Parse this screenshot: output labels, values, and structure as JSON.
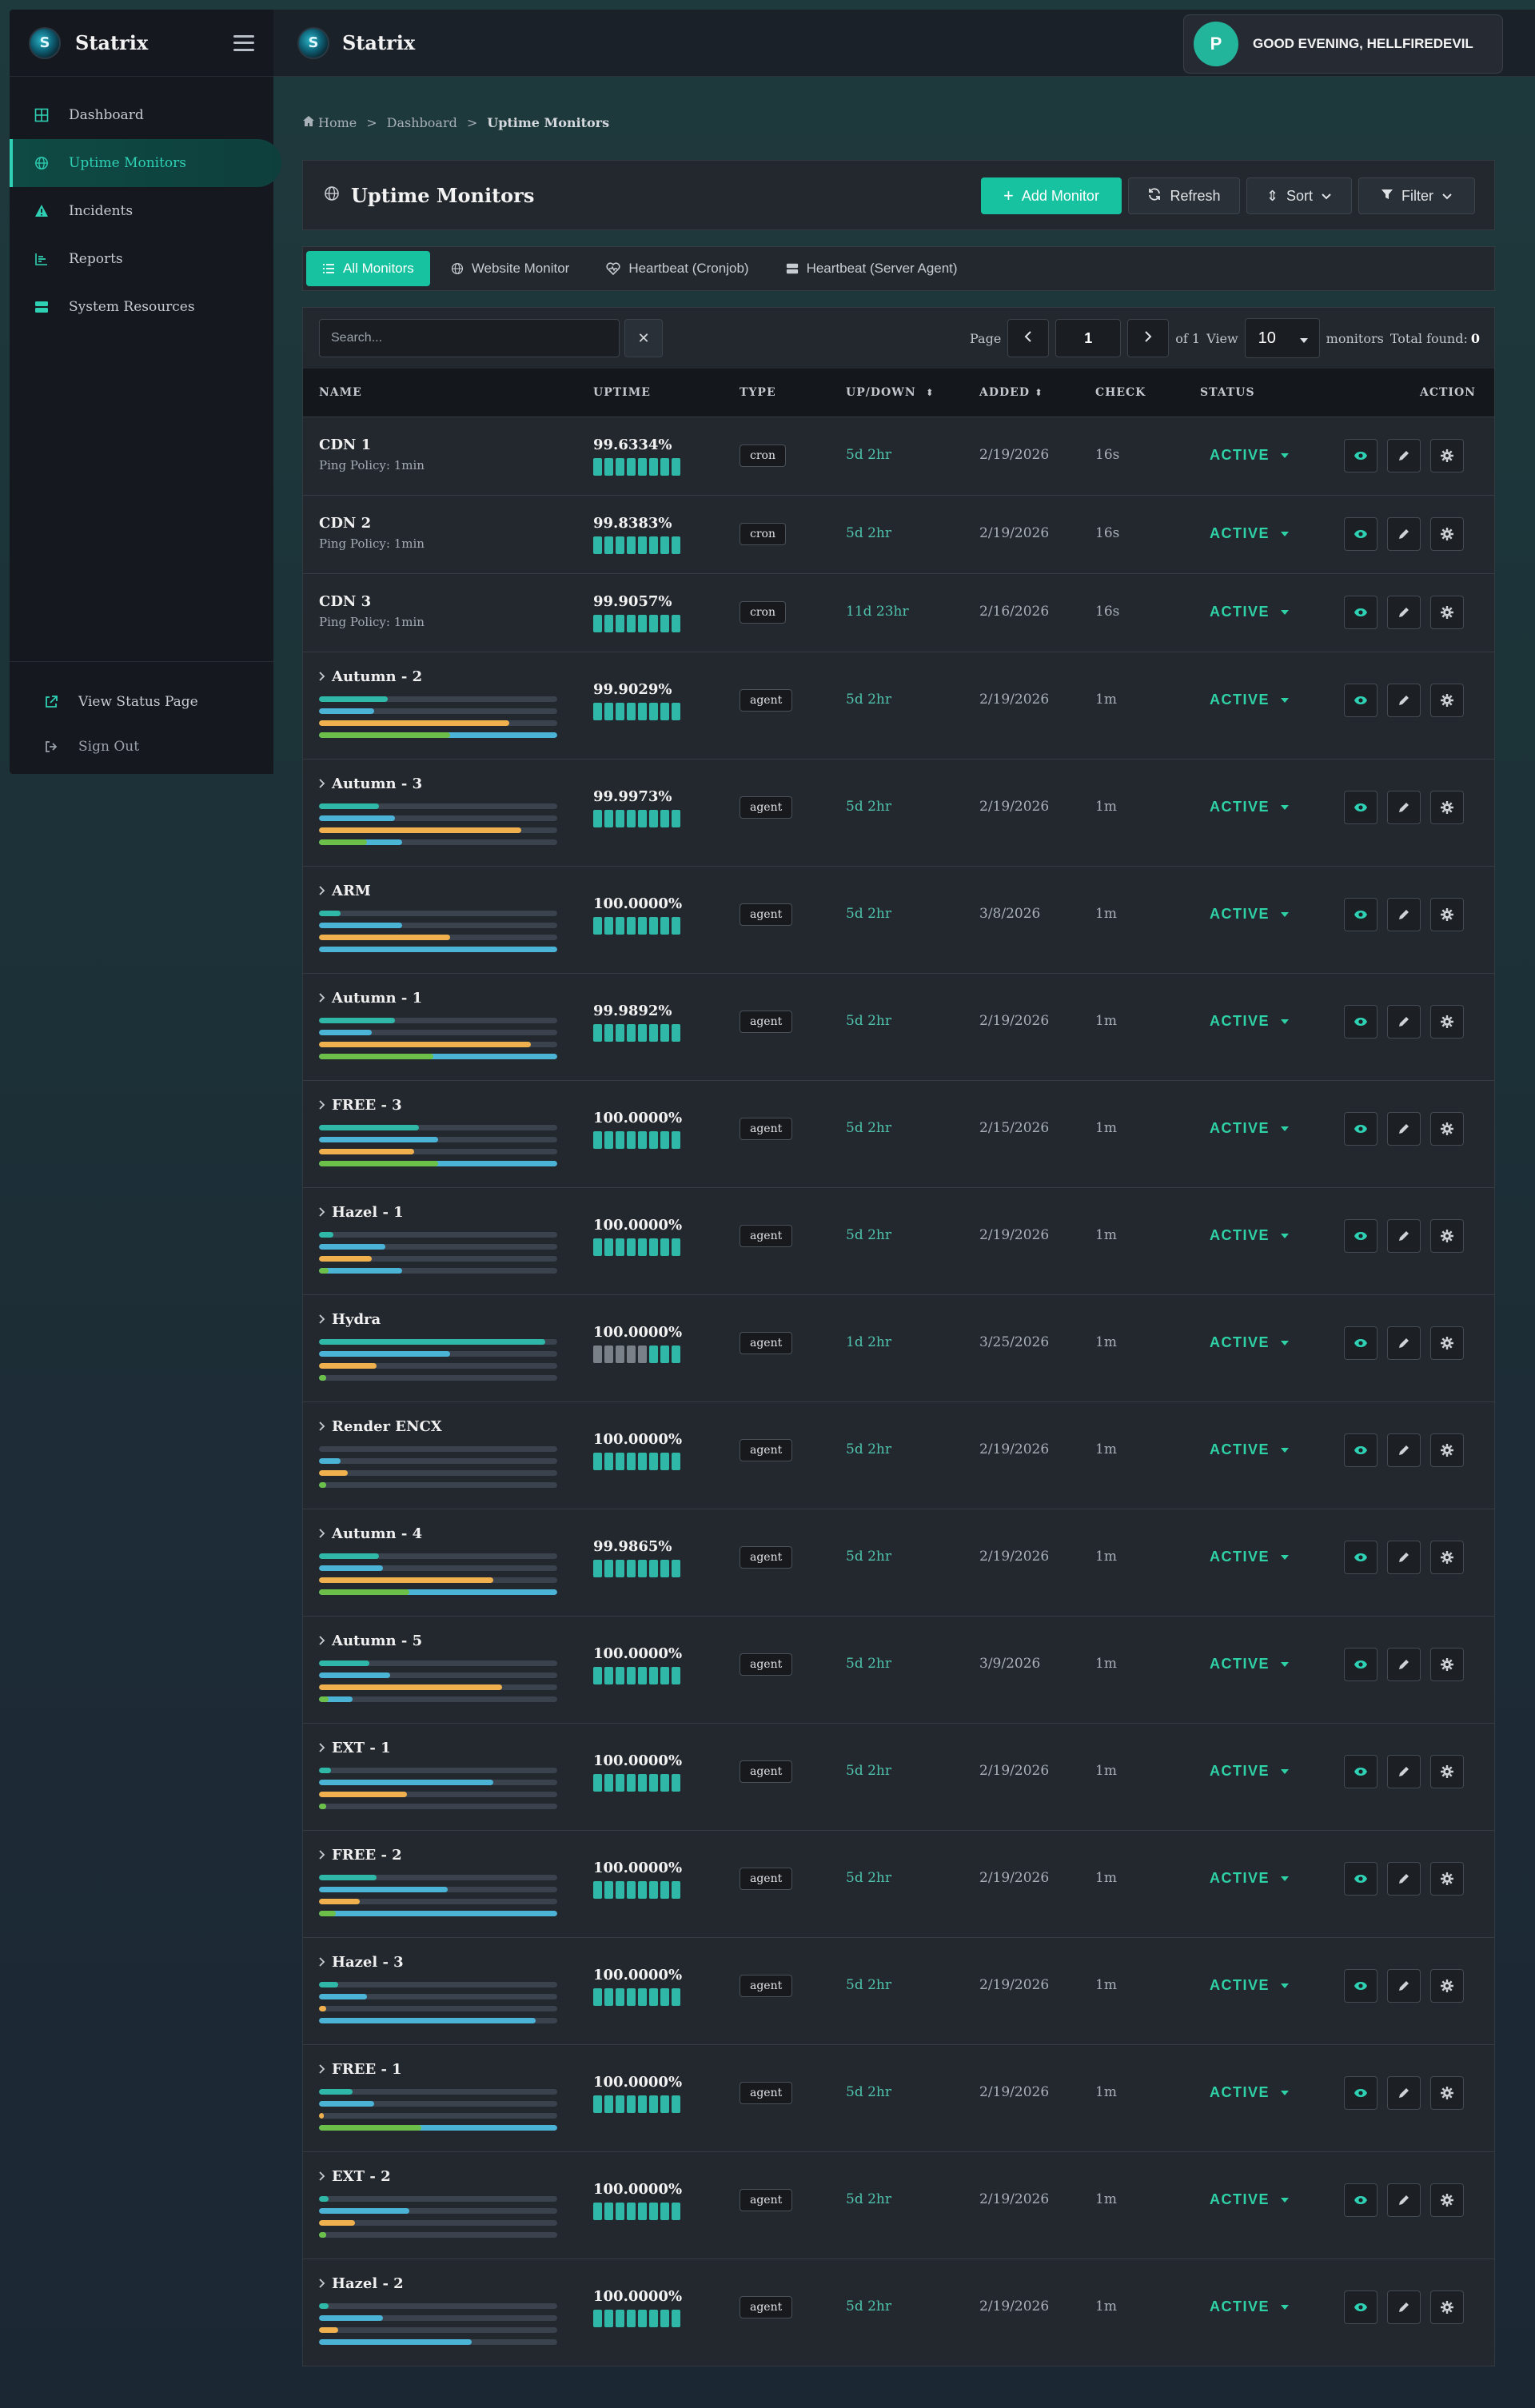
{
  "app": {
    "name": "Statrix",
    "logo_letter": "S"
  },
  "sidebar": {
    "items": [
      {
        "label": "Dashboard",
        "icon": "grid-icon",
        "active": false
      },
      {
        "label": "Uptime Monitors",
        "icon": "globe-icon",
        "active": true
      },
      {
        "label": "Incidents",
        "icon": "warning-icon",
        "active": false
      },
      {
        "label": "Reports",
        "icon": "chart-icon",
        "active": false
      },
      {
        "label": "System Resources",
        "icon": "server-icon",
        "active": false
      }
    ],
    "bottom": [
      {
        "label": "View Status Page",
        "icon": "external-link-icon"
      },
      {
        "label": "Sign Out",
        "icon": "sign-out-icon"
      }
    ]
  },
  "header": {
    "avatar_letter": "P",
    "greeting": "GOOD EVENING, HELLFIREDEVIL"
  },
  "breadcrumb": {
    "home": "Home",
    "sep": ">",
    "parent": "Dashboard",
    "current": "Uptime Monitors"
  },
  "page": {
    "title": "Uptime Monitors",
    "add_label": "Add Monitor",
    "refresh_label": "Refresh",
    "sort_label": "Sort",
    "filter_label": "Filter"
  },
  "tabs": [
    {
      "label": "All Monitors",
      "active": true
    },
    {
      "label": "Website Monitor",
      "active": false
    },
    {
      "label": "Heartbeat (Cronjob)",
      "active": false
    },
    {
      "label": "Heartbeat (Server Agent)",
      "active": false
    }
  ],
  "table": {
    "search_placeholder": "Search...",
    "clear": "✕",
    "page_label": "Page",
    "page": "1",
    "of_label": "of 1",
    "view_label": "View",
    "view_count": "10",
    "monitors_label": "monitors",
    "total_label": "Total found:",
    "total": "0",
    "headers": {
      "name": "NAME",
      "uptime": "UPTIME",
      "type": "TYPE",
      "updown": "UP/DOWN",
      "added": "ADDED",
      "check": "CHECK",
      "status": "STATUS",
      "action": "ACTION"
    },
    "rows": [
      {
        "name": "CDN 1",
        "policy": "Ping Policy: 1min",
        "uptime": "99.6334%",
        "type": "cron",
        "updown": "5d 2hr",
        "added": "2/19/2026",
        "check": "16s",
        "status": "ACTIVE"
      },
      {
        "name": "CDN 2",
        "policy": "Ping Policy: 1min",
        "uptime": "99.8383%",
        "type": "cron",
        "updown": "5d 2hr",
        "added": "2/19/2026",
        "check": "16s",
        "status": "ACTIVE"
      },
      {
        "name": "CDN 3",
        "policy": "Ping Policy: 1min",
        "uptime": "99.9057%",
        "type": "cron",
        "updown": "11d 23hr",
        "added": "2/16/2026",
        "check": "16s",
        "status": "ACTIVE"
      },
      {
        "name": "Autumn - 2",
        "uptime": "99.9029%",
        "type": "agent",
        "updown": "5d 2hr",
        "added": "2/19/2026",
        "check": "1m",
        "status": "ACTIVE",
        "bars": [
          [
            0.29,
            "#2fb8a7"
          ],
          [
            0.23,
            "#4ab3d6"
          ],
          [
            0.8,
            "#f0b04e"
          ],
          [
            1.0,
            "#4ab3d6",
            0.55
          ]
        ]
      },
      {
        "name": "Autumn - 3",
        "uptime": "99.9973%",
        "type": "agent",
        "updown": "5d 2hr",
        "added": "2/19/2026",
        "check": "1m",
        "status": "ACTIVE",
        "bars": [
          [
            0.25,
            "#2fb8a7"
          ],
          [
            0.32,
            "#4ab3d6"
          ],
          [
            0.85,
            "#f0b04e"
          ],
          [
            0.35,
            "#4ab3d6",
            0.2
          ]
        ]
      },
      {
        "name": "ARM",
        "uptime": "100.0000%",
        "type": "agent",
        "updown": "5d 2hr",
        "added": "3/8/2026",
        "check": "1m",
        "status": "ACTIVE",
        "bars": [
          [
            0.09,
            "#2fb8a7"
          ],
          [
            0.35,
            "#4ab3d6"
          ],
          [
            0.55,
            "#f0b04e"
          ],
          [
            1.0,
            "#4ab3d6",
            0.0
          ]
        ]
      },
      {
        "name": "Autumn - 1",
        "uptime": "99.9892%",
        "type": "agent",
        "updown": "5d 2hr",
        "added": "2/19/2026",
        "check": "1m",
        "status": "ACTIVE",
        "bars": [
          [
            0.32,
            "#2fb8a7"
          ],
          [
            0.22,
            "#4ab3d6"
          ],
          [
            0.89,
            "#f0b04e"
          ],
          [
            1.0,
            "#4ab3d6",
            0.48
          ]
        ]
      },
      {
        "name": "FREE - 3",
        "uptime": "100.0000%",
        "type": "agent",
        "updown": "5d 2hr",
        "added": "2/15/2026",
        "check": "1m",
        "status": "ACTIVE",
        "bars": [
          [
            0.42,
            "#2fb8a7"
          ],
          [
            0.5,
            "#4ab3d6"
          ],
          [
            0.4,
            "#f0b04e"
          ],
          [
            1.0,
            "#4ab3d6",
            0.5
          ]
        ]
      },
      {
        "name": "Hazel - 1",
        "uptime": "100.0000%",
        "type": "agent",
        "updown": "5d 2hr",
        "added": "2/19/2026",
        "check": "1m",
        "status": "ACTIVE",
        "bars": [
          [
            0.06,
            "#2fb8a7"
          ],
          [
            0.28,
            "#4ab3d6"
          ],
          [
            0.22,
            "#f0b04e"
          ],
          [
            0.35,
            "#4ab3d6",
            0.04
          ]
        ]
      },
      {
        "name": "Hydra",
        "uptime": "100.0000%",
        "type": "agent",
        "updown": "1d 2hr",
        "added": "3/25/2026",
        "check": "1m",
        "status": "ACTIVE",
        "grey_blocks": 5,
        "bars": [
          [
            0.95,
            "#2fb8a7"
          ],
          [
            0.55,
            "#4ab3d6"
          ],
          [
            0.24,
            "#f0b04e"
          ],
          [
            0.03,
            "#4ab3d6",
            0.03
          ]
        ]
      },
      {
        "name": "Render ENCX",
        "uptime": "100.0000%",
        "type": "agent",
        "updown": "5d 2hr",
        "added": "2/19/2026",
        "check": "1m",
        "status": "ACTIVE",
        "bars": [
          [
            0.0,
            "#2fb8a7"
          ],
          [
            0.09,
            "#4ab3d6"
          ],
          [
            0.12,
            "#f0b04e"
          ],
          [
            0.03,
            "#4ab3d6",
            0.03
          ]
        ]
      },
      {
        "name": "Autumn - 4",
        "uptime": "99.9865%",
        "type": "agent",
        "updown": "5d 2hr",
        "added": "2/19/2026",
        "check": "1m",
        "status": "ACTIVE",
        "bars": [
          [
            0.25,
            "#2fb8a7"
          ],
          [
            0.27,
            "#4ab3d6"
          ],
          [
            0.73,
            "#f0b04e"
          ],
          [
            1.0,
            "#4ab3d6",
            0.38
          ]
        ]
      },
      {
        "name": "Autumn - 5",
        "uptime": "100.0000%",
        "type": "agent",
        "updown": "5d 2hr",
        "added": "3/9/2026",
        "check": "1m",
        "status": "ACTIVE",
        "bars": [
          [
            0.21,
            "#2fb8a7"
          ],
          [
            0.3,
            "#4ab3d6"
          ],
          [
            0.77,
            "#f0b04e"
          ],
          [
            0.14,
            "#4ab3d6",
            0.04
          ]
        ]
      },
      {
        "name": "EXT - 1",
        "uptime": "100.0000%",
        "type": "agent",
        "updown": "5d 2hr",
        "added": "2/19/2026",
        "check": "1m",
        "status": "ACTIVE",
        "bars": [
          [
            0.05,
            "#2fb8a7"
          ],
          [
            0.73,
            "#4ab3d6"
          ],
          [
            0.37,
            "#f0b04e"
          ],
          [
            0.03,
            "#4ab3d6",
            0.03
          ]
        ]
      },
      {
        "name": "FREE - 2",
        "uptime": "100.0000%",
        "type": "agent",
        "updown": "5d 2hr",
        "added": "2/19/2026",
        "check": "1m",
        "status": "ACTIVE",
        "bars": [
          [
            0.24,
            "#2fb8a7"
          ],
          [
            0.54,
            "#4ab3d6"
          ],
          [
            0.17,
            "#f0b04e"
          ],
          [
            1.0,
            "#4ab3d6",
            0.07
          ]
        ]
      },
      {
        "name": "Hazel - 3",
        "uptime": "100.0000%",
        "type": "agent",
        "updown": "5d 2hr",
        "added": "2/19/2026",
        "check": "1m",
        "status": "ACTIVE",
        "bars": [
          [
            0.08,
            "#2fb8a7"
          ],
          [
            0.2,
            "#4ab3d6"
          ],
          [
            0.03,
            "#f0b04e"
          ],
          [
            0.91,
            "#4ab3d6",
            0.0
          ]
        ]
      },
      {
        "name": "FREE - 1",
        "uptime": "100.0000%",
        "type": "agent",
        "updown": "5d 2hr",
        "added": "2/19/2026",
        "check": "1m",
        "status": "ACTIVE",
        "bars": [
          [
            0.14,
            "#2fb8a7"
          ],
          [
            0.23,
            "#4ab3d6"
          ],
          [
            0.02,
            "#f0b04e"
          ],
          [
            1.0,
            "#4ab3d6",
            0.43
          ]
        ]
      },
      {
        "name": "EXT - 2",
        "uptime": "100.0000%",
        "type": "agent",
        "updown": "5d 2hr",
        "added": "2/19/2026",
        "check": "1m",
        "status": "ACTIVE",
        "bars": [
          [
            0.04,
            "#2fb8a7"
          ],
          [
            0.38,
            "#4ab3d6"
          ],
          [
            0.15,
            "#f0b04e"
          ],
          [
            0.03,
            "#4ab3d6",
            0.03
          ]
        ]
      },
      {
        "name": "Hazel - 2",
        "uptime": "100.0000%",
        "type": "agent",
        "updown": "5d 2hr",
        "added": "2/19/2026",
        "check": "1m",
        "status": "ACTIVE",
        "bars": [
          [
            0.04,
            "#2fb8a7"
          ],
          [
            0.27,
            "#4ab3d6"
          ],
          [
            0.08,
            "#f0b04e"
          ],
          [
            0.64,
            "#4ab3d6",
            0.0
          ]
        ]
      }
    ]
  },
  "colors": {
    "accent": "#17c2a0",
    "active_status": "#2fd1a6",
    "bar_green": "#6cc04a"
  }
}
